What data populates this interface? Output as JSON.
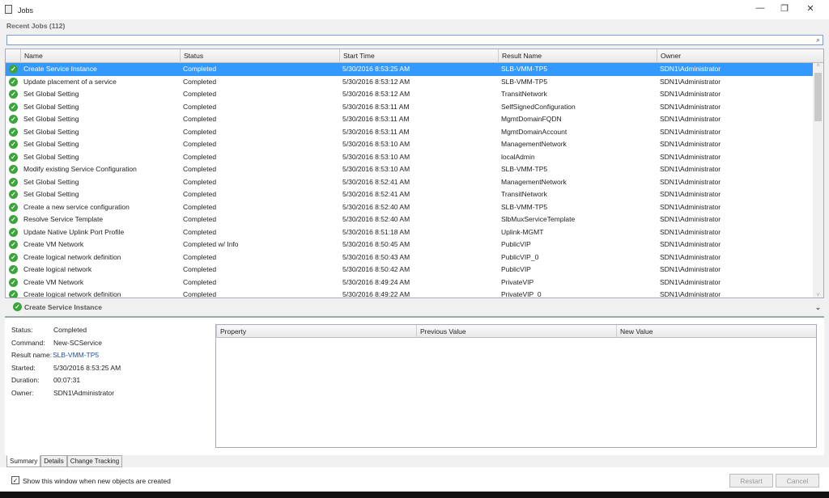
{
  "window": {
    "title": "Jobs",
    "minimize": "—",
    "restore": "❐",
    "close": "✕"
  },
  "recent_label": "Recent Jobs (112)",
  "search": {
    "value": "",
    "icon": "search-icon"
  },
  "columns": [
    "Name",
    "Status",
    "Start Time",
    "Result Name",
    "Owner"
  ],
  "rows": [
    [
      "Create Service Instance",
      "Completed",
      "5/30/2016 8:53:25 AM",
      "SLB-VMM-TP5",
      "SDN1\\Administrator"
    ],
    [
      "Update placement of a service",
      "Completed",
      "5/30/2016 8:53:12 AM",
      "SLB-VMM-TP5",
      "SDN1\\Administrator"
    ],
    [
      "Set Global Setting",
      "Completed",
      "5/30/2016 8:53:12 AM",
      "TransitNetwork",
      "SDN1\\Administrator"
    ],
    [
      "Set Global Setting",
      "Completed",
      "5/30/2016 8:53:11 AM",
      "SelfSignedConfiguration",
      "SDN1\\Administrator"
    ],
    [
      "Set Global Setting",
      "Completed",
      "5/30/2016 8:53:11 AM",
      "MgmtDomainFQDN",
      "SDN1\\Administrator"
    ],
    [
      "Set Global Setting",
      "Completed",
      "5/30/2016 8:53:11 AM",
      "MgmtDomainAccount",
      "SDN1\\Administrator"
    ],
    [
      "Set Global Setting",
      "Completed",
      "5/30/2016 8:53:10 AM",
      "ManagementNetwork",
      "SDN1\\Administrator"
    ],
    [
      "Set Global Setting",
      "Completed",
      "5/30/2016 8:53:10 AM",
      "localAdmin",
      "SDN1\\Administrator"
    ],
    [
      "Modify existing Service Configuration",
      "Completed",
      "5/30/2016 8:53:10 AM",
      "SLB-VMM-TP5",
      "SDN1\\Administrator"
    ],
    [
      "Set Global Setting",
      "Completed",
      "5/30/2016 8:52:41 AM",
      "ManagementNetwork",
      "SDN1\\Administrator"
    ],
    [
      "Set Global Setting",
      "Completed",
      "5/30/2016 8:52:41 AM",
      "TransitNetwork",
      "SDN1\\Administrator"
    ],
    [
      "Create a new service configuration",
      "Completed",
      "5/30/2016 8:52:40 AM",
      "SLB-VMM-TP5",
      "SDN1\\Administrator"
    ],
    [
      "Resolve Service Template",
      "Completed",
      "5/30/2016 8:52:40 AM",
      "SlbMuxServiceTemplate",
      "SDN1\\Administrator"
    ],
    [
      "Update Native Uplink Port Profile",
      "Completed",
      "5/30/2016 8:51:18 AM",
      "Uplink-MGMT",
      "SDN1\\Administrator"
    ],
    [
      "Create VM Network",
      "Completed w/ Info",
      "5/30/2016 8:50:45 AM",
      "PublicVIP",
      "SDN1\\Administrator"
    ],
    [
      "Create logical network definition",
      "Completed",
      "5/30/2016 8:50:43 AM",
      "PublicVIP_0",
      "SDN1\\Administrator"
    ],
    [
      "Create logical network",
      "Completed",
      "5/30/2016 8:50:42 AM",
      "PublicVIP",
      "SDN1\\Administrator"
    ],
    [
      "Create VM Network",
      "Completed",
      "5/30/2016 8:49:24 AM",
      "PrivateVIP",
      "SDN1\\Administrator"
    ],
    [
      "Create logical network definition",
      "Completed",
      "5/30/2016 8:49:22 AM",
      "PrivateVIP_0",
      "SDN1\\Administrator"
    ]
  ],
  "selected_index": 0,
  "details": {
    "title": "Create Service Instance",
    "fields": [
      {
        "label": "Status:",
        "value": "Completed"
      },
      {
        "label": "Command:",
        "value": "New-SCService"
      },
      {
        "label": "Result name:",
        "value": "SLB-VMM-TP5"
      },
      {
        "label": "Started:",
        "value": "5/30/2016 8:53:25 AM"
      },
      {
        "label": "Duration:",
        "value": "00:07:31"
      },
      {
        "label": "Owner:",
        "value": "SDN1\\Administrator"
      }
    ],
    "property_columns": [
      "Property",
      "Previous Value",
      "New Value"
    ]
  },
  "tabs": [
    "Summary",
    "Details",
    "Change Tracking"
  ],
  "active_tab": "Summary",
  "footer": {
    "show_window_label": "Show this window when new objects are created",
    "show_window_checked": true,
    "restart": "Restart",
    "cancel": "Cancel"
  },
  "colors": {
    "selection": "#3399ff",
    "success": "#3ba53b",
    "link": "#1f4e9c"
  }
}
